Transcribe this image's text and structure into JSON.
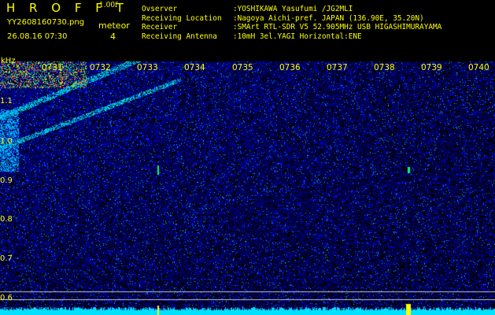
{
  "header": {
    "brand": "H R O F F T",
    "version": "1.00f",
    "filename": "YY2608160730.png",
    "timestamp": "26.08.16 07:30",
    "meteor_label": "meteor",
    "meteor_count": "4"
  },
  "info": [
    {
      "key": "Ovserver",
      "value": ":YOSHIKAWA Yasufumi /JG2MLI"
    },
    {
      "key": "Receiving Location",
      "value": ":Nagoya Aichi-pref. JAPAN (136.90E, 35.20N)"
    },
    {
      "key": "Receiver",
      "value": ":SMArt RTL-SDR V5 52.905MHz USB HIGASHIMURAYAMA"
    },
    {
      "key": "Receiving Antenna",
      "value": ":10mH 3el.YAGI Horizontal:ENE"
    }
  ],
  "axis": {
    "y_unit": "kHz",
    "y_ticks": [
      "1.1",
      "1.0",
      "0.9",
      "0.8",
      "0.7",
      "0.6"
    ],
    "x_ticks": [
      "0731",
      "0732",
      "0733",
      "0734",
      "0735",
      "0736",
      "0737",
      "0738",
      "0739",
      "0740"
    ]
  },
  "colors": {
    "label": "#ffff00",
    "background": "#000000",
    "noise_blue": "#0000ff",
    "signal_cyan": "#00e0ff",
    "marker_line": "#c8c8c8"
  }
}
